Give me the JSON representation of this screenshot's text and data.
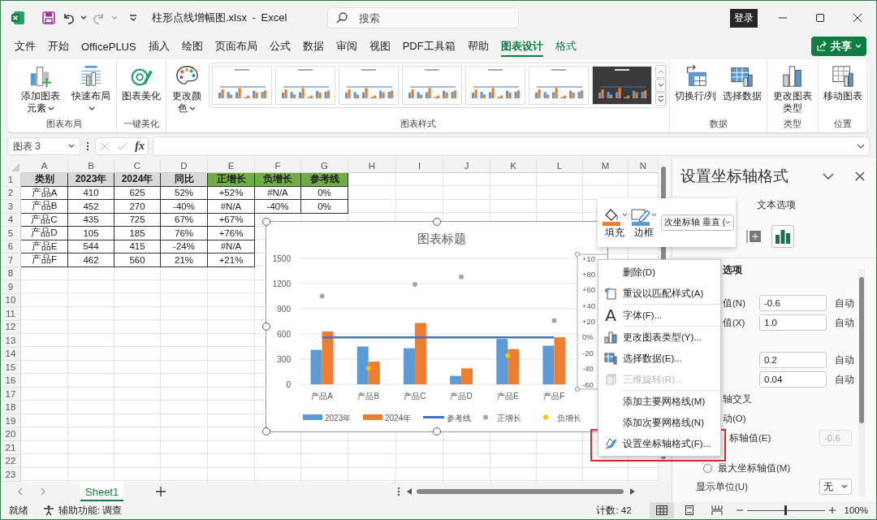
{
  "title_bar": {
    "title": "柱形点线增幅图.xlsx - Excel",
    "search": {
      "placeholder": "搜索"
    },
    "sign_in": "登录"
  },
  "menu_tabs": [
    {
      "label": "文件",
      "selected": false,
      "contextual": false
    },
    {
      "label": "开始",
      "selected": false,
      "contextual": false
    },
    {
      "label": "OfficePLUS",
      "selected": false,
      "contextual": false
    },
    {
      "label": "插入",
      "selected": false,
      "contextual": false
    },
    {
      "label": "绘图",
      "selected": false,
      "contextual": false
    },
    {
      "label": "页面布局",
      "selected": false,
      "contextual": false
    },
    {
      "label": "公式",
      "selected": false,
      "contextual": false
    },
    {
      "label": "数据",
      "selected": false,
      "contextual": false
    },
    {
      "label": "审阅",
      "selected": false,
      "contextual": false
    },
    {
      "label": "视图",
      "selected": false,
      "contextual": false
    },
    {
      "label": "PDF工具箱",
      "selected": false,
      "contextual": false
    },
    {
      "label": "帮助",
      "selected": false,
      "contextual": false
    },
    {
      "label": "图表设计",
      "selected": true,
      "contextual": true
    },
    {
      "label": "格式",
      "selected": false,
      "contextual": true
    }
  ],
  "share_button": "共享",
  "ribbon": {
    "groups": [
      {
        "label": "图表布局",
        "buttons": [
          {
            "label": "添加图表元素",
            "dropdown": true
          },
          {
            "label": "快速布局",
            "dropdown": true
          }
        ]
      },
      {
        "label": "一键美化",
        "buttons": [
          {
            "label": "图表美化",
            "dropdown": false
          }
        ]
      },
      {
        "label": "图表样式",
        "buttons": [
          {
            "label": "更改颜色",
            "dropdown": true
          }
        ],
        "gallery": [
          {
            "kind": "light"
          },
          {
            "kind": "light"
          },
          {
            "kind": "light"
          },
          {
            "kind": "light"
          },
          {
            "kind": "light"
          },
          {
            "kind": "light"
          },
          {
            "kind": "dark"
          }
        ]
      },
      {
        "label": "数据",
        "buttons": [
          {
            "label": "切换行/列",
            "dropdown": false
          },
          {
            "label": "选择数据",
            "dropdown": false
          }
        ]
      },
      {
        "label": "类型",
        "buttons": [
          {
            "label": "更改图表类型",
            "dropdown": false
          }
        ]
      },
      {
        "label": "位置",
        "buttons": [
          {
            "label": "移动图表",
            "dropdown": false
          }
        ]
      }
    ]
  },
  "formula_bar": {
    "name_box": "图表 3",
    "function_label": "fx"
  },
  "sheet": {
    "columns": [
      "A",
      "B",
      "C",
      "D",
      "E",
      "F",
      "G",
      "H",
      "I",
      "J",
      "K",
      "L",
      "M",
      "N"
    ],
    "rows": [
      "1",
      "2",
      "3",
      "4",
      "5",
      "6",
      "7",
      "8",
      "9",
      "10",
      "11",
      "12",
      "13",
      "14",
      "15",
      "16",
      "17",
      "18",
      "19",
      "20",
      "21",
      "22",
      "23"
    ],
    "cells": [
      [
        {
          "text": "类别",
          "kind": "header"
        },
        {
          "text": "2023年",
          "kind": "header"
        },
        {
          "text": "2024年",
          "kind": "header"
        },
        {
          "text": "同比",
          "kind": "header"
        },
        {
          "text": "正增长",
          "kind": "header-accent"
        },
        {
          "text": "负增长",
          "kind": "header-accent"
        },
        {
          "text": "参考线",
          "kind": "header-accent"
        }
      ],
      [
        {
          "text": "产品A",
          "kind": "data"
        },
        {
          "text": "410",
          "kind": "data"
        },
        {
          "text": "625",
          "kind": "data"
        },
        {
          "text": "52%",
          "kind": "data"
        },
        {
          "text": "+52%",
          "kind": "data"
        },
        {
          "text": "#N/A",
          "kind": "data"
        },
        {
          "text": "0%",
          "kind": "data"
        }
      ],
      [
        {
          "text": "产品B",
          "kind": "data"
        },
        {
          "text": "452",
          "kind": "data"
        },
        {
          "text": "270",
          "kind": "data"
        },
        {
          "text": "-40%",
          "kind": "data"
        },
        {
          "text": "#N/A",
          "kind": "data"
        },
        {
          "text": "-40%",
          "kind": "data"
        },
        {
          "text": "0%",
          "kind": "data"
        }
      ],
      [
        {
          "text": "产品C",
          "kind": "data"
        },
        {
          "text": "435",
          "kind": "data"
        },
        {
          "text": "725",
          "kind": "data"
        },
        {
          "text": "67%",
          "kind": "data"
        },
        {
          "text": "+67%",
          "kind": "data"
        }
      ],
      [
        {
          "text": "产品D",
          "kind": "data"
        },
        {
          "text": "105",
          "kind": "data"
        },
        {
          "text": "185",
          "kind": "data"
        },
        {
          "text": "76%",
          "kind": "data"
        },
        {
          "text": "+76%",
          "kind": "data"
        }
      ],
      [
        {
          "text": "产品E",
          "kind": "data"
        },
        {
          "text": "544",
          "kind": "data"
        },
        {
          "text": "415",
          "kind": "data"
        },
        {
          "text": "-24%",
          "kind": "data"
        },
        {
          "text": "#N/A",
          "kind": "data"
        }
      ],
      [
        {
          "text": "产品F",
          "kind": "data"
        },
        {
          "text": "462",
          "kind": "data"
        },
        {
          "text": "560",
          "kind": "data"
        },
        {
          "text": "21%",
          "kind": "data"
        },
        {
          "text": "+21%",
          "kind": "data"
        }
      ]
    ]
  },
  "chart": {
    "secondary_axis_labels": [
      "+10",
      "+80",
      "+60",
      "+40",
      "+20",
      "0%",
      "-20",
      "-40",
      "-60"
    ],
    "chart_data": {
      "type": "bar",
      "title": "图表标题",
      "grid": true,
      "legend": "bottom",
      "categories": [
        "产品A",
        "产品B",
        "产品C",
        "产品D",
        "产品E",
        "产品F"
      ],
      "ylim": [
        0,
        1500
      ],
      "yticks": [
        0,
        300,
        600,
        900,
        1200,
        1500
      ],
      "series": [
        {
          "name": "2023年",
          "type": "bar",
          "color": "#5b9bd5",
          "values": [
            410,
            450,
            430,
            100,
            540,
            460
          ]
        },
        {
          "name": "2024年",
          "type": "bar",
          "color": "#ed7d31",
          "values": [
            630,
            270,
            730,
            190,
            420,
            560
          ]
        },
        {
          "name": "参考线",
          "type": "line",
          "color": "#4472c4",
          "values": [
            560,
            560,
            560,
            560,
            560,
            560
          ]
        },
        {
          "name": "正增长",
          "type": "scatter",
          "color": "#a5a5a5",
          "values": [
            1050,
            null,
            1190,
            1280,
            null,
            760
          ]
        },
        {
          "name": "负增长",
          "type": "scatter",
          "color": "#ffc000",
          "values": [
            null,
            190,
            null,
            null,
            340,
            null
          ]
        }
      ]
    }
  },
  "mini_toolbar": {
    "fill": "填充",
    "border": "边框",
    "element": "次坐标轴 垂直 ("
  },
  "context_menu": [
    {
      "kind": "item",
      "label": "删除(D)",
      "disabled": false
    },
    {
      "kind": "item",
      "label": "重设以匹配样式(A)",
      "disabled": false
    },
    {
      "kind": "separator"
    },
    {
      "kind": "item",
      "label": "字体(F)...",
      "glyph": "A",
      "disabled": false
    },
    {
      "kind": "separator"
    },
    {
      "kind": "item",
      "label": "更改图表类型(Y)...",
      "disabled": false
    },
    {
      "kind": "item",
      "label": "选择数据(E)...",
      "disabled": false
    },
    {
      "kind": "item",
      "label": "三维旋转(R)...",
      "disabled": true
    },
    {
      "kind": "separator"
    },
    {
      "kind": "item",
      "label": "添加主要网格线(M)",
      "disabled": false
    },
    {
      "kind": "item",
      "label": "添加次要网格线(N)",
      "disabled": false
    },
    {
      "kind": "item",
      "label": "设置坐标轴格式(F)...",
      "disabled": false
    }
  ],
  "pane": {
    "title": "设置坐标轴格式",
    "tabs": [
      {
        "label": "文本选项",
        "selected": false
      }
    ],
    "icons": [
      {
        "kind": "size",
        "selected": false
      },
      {
        "kind": "axis-options",
        "selected": true
      }
    ],
    "groups": [
      [
        {
          "kind": "heading",
          "label": "选项"
        }
      ],
      [
        {
          "kind": "field",
          "label": "值(N)",
          "value": "-0.6",
          "note": "自动",
          "disabled": false
        },
        {
          "kind": "field",
          "label": "值(X)",
          "value": "1.0",
          "note": "自动",
          "disabled": false
        }
      ],
      [
        {
          "kind": "field",
          "value": "0.2",
          "note": "自动",
          "disabled": false
        },
        {
          "kind": "field",
          "value": "0.04",
          "note": "自动",
          "disabled": false
        },
        {
          "kind": "text",
          "label": "轴交叉"
        },
        {
          "kind": "text",
          "label": "动(O)"
        },
        {
          "kind": "field",
          "label": "标轴值(E)",
          "value": "-0.6",
          "disabled": true
        },
        {
          "kind": "radio",
          "label": "最大坐标轴值(M)",
          "selected": false
        },
        {
          "kind": "select",
          "label": "显示单位(U)",
          "value": "无"
        }
      ]
    ]
  },
  "sheet_tabs": [
    {
      "label": "Sheet1",
      "selected": true
    }
  ],
  "status_bar": {
    "ready": "就绪",
    "accessibility": "辅助功能: 调查",
    "count": "计数: 42",
    "views": [
      {
        "kind": "normal",
        "selected": true
      },
      {
        "kind": "page-layout",
        "selected": false
      },
      {
        "kind": "page-break",
        "selected": false
      }
    ],
    "zoom": {
      "level": 0.5,
      "label": "100%"
    }
  }
}
